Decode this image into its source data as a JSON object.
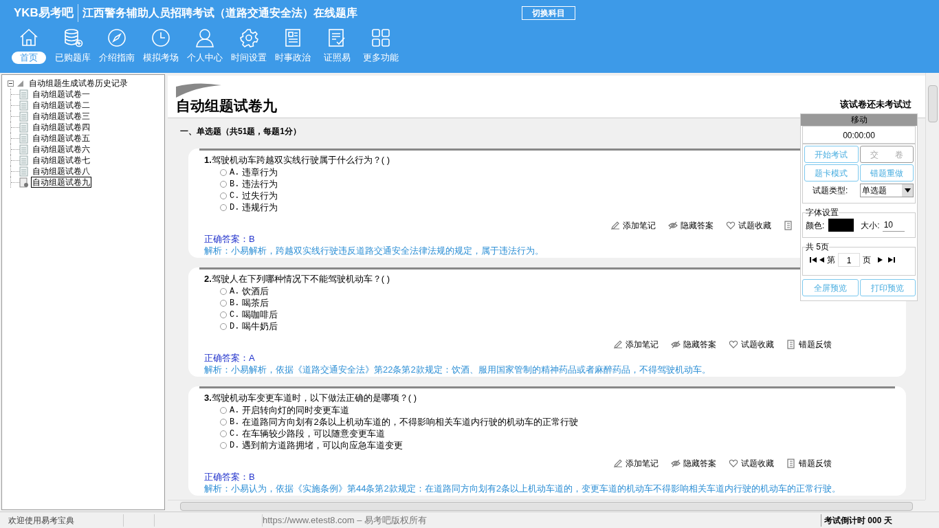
{
  "header": {
    "logo": "YKB易考吧",
    "title": "江西警务辅助人员招聘考试（道路交通安全法）在线题库",
    "switch_button": "切换科目"
  },
  "toolbar": [
    {
      "label": "首页",
      "selected": true
    },
    {
      "label": "已购题库",
      "selected": false
    },
    {
      "label": "介绍指南",
      "selected": false
    },
    {
      "label": "模拟考场",
      "selected": false
    },
    {
      "label": "个人中心",
      "selected": false
    },
    {
      "label": "时间设置",
      "selected": false
    },
    {
      "label": "时事政治",
      "selected": false
    },
    {
      "label": "证照易",
      "selected": false
    },
    {
      "label": "更多功能",
      "selected": false
    }
  ],
  "tree": {
    "label": "自动组题生成试卷历史记录",
    "expanded": true,
    "children": [
      {
        "label": "自动组题试卷一",
        "selected": false
      },
      {
        "label": "自动组题试卷二",
        "selected": false
      },
      {
        "label": "自动组题试卷三",
        "selected": false
      },
      {
        "label": "自动组题试卷四",
        "selected": false
      },
      {
        "label": "自动组题试卷五",
        "selected": false
      },
      {
        "label": "自动组题试卷六",
        "selected": false
      },
      {
        "label": "自动组题试卷七",
        "selected": false
      },
      {
        "label": "自动组题试卷八",
        "selected": false
      },
      {
        "label": "自动组题试卷九",
        "selected": true
      }
    ]
  },
  "paper": {
    "title": "自动组题试卷九",
    "status": "该试卷还未考试过",
    "section": "一、单选题（共51题，每题1分）"
  },
  "questions": [
    {
      "number": "1.",
      "text": "驾驶机动车跨越双实线行驶属于什么行为？( )",
      "options": [
        {
          "letter": "A.",
          "text": "违章行为",
          "selected": false
        },
        {
          "letter": "B.",
          "text": "违法行为",
          "selected": false
        },
        {
          "letter": "C.",
          "text": "过失行为",
          "selected": false
        },
        {
          "letter": "D.",
          "text": "违规行为",
          "selected": false
        }
      ],
      "answer": "正确答案：B",
      "analysis": "解析：小易解析，跨越双实线行驶违反道路交通安全法律法规的规定，属于违法行为。",
      "actions": [
        "添加笔记",
        "隐藏答案",
        "试题收藏"
      ]
    },
    {
      "number": "2.",
      "text": "驾驶人在下列哪种情况下不能驾驶机动车？( )",
      "options": [
        {
          "letter": "A.",
          "text": "饮酒后",
          "selected": false
        },
        {
          "letter": "B.",
          "text": "喝茶后",
          "selected": false
        },
        {
          "letter": "C.",
          "text": "喝咖啡后",
          "selected": false
        },
        {
          "letter": "D.",
          "text": "喝牛奶后",
          "selected": false
        }
      ],
      "answer": "正确答案：A",
      "analysis": "解析：小易解析，依据《道路交通安全法》第22条第2款规定：饮酒、服用国家管制的精神药品或者麻醉药品，不得驾驶机动车。",
      "actions": [
        "添加笔记",
        "隐藏答案",
        "试题收藏",
        "错题反馈"
      ]
    },
    {
      "number": "3.",
      "text": "驾驶机动车变更车道时，以下做法正确的是哪项？( )",
      "options": [
        {
          "letter": "A.",
          "text": "开启转向灯的同时变更车道",
          "selected": false
        },
        {
          "letter": "B.",
          "text": "在道路同方向划有2条以上机动车道的，不得影响相关车道内行驶的机动车的正常行驶",
          "selected": false
        },
        {
          "letter": "C.",
          "text": "在车辆较少路段，可以随意变更车道",
          "selected": false
        },
        {
          "letter": "D.",
          "text": "遇到前方道路拥堵，可以向应急车道变更",
          "selected": false
        }
      ],
      "answer": "正确答案：B",
      "analysis": "解析：小易认为，依据《实施条例》第44条第2款规定：在道路同方向划有2条以上机动车道的，变更车道的机动车不得影响相关车道内行驶的机动车的正常行驶。",
      "actions": [
        "添加笔记",
        "隐藏答案",
        "试题收藏",
        "错题反馈"
      ]
    }
  ],
  "panel": {
    "handle": "移动",
    "timer": "00:00:00",
    "buttons": [
      {
        "label": "开始考试",
        "disabled": false
      },
      {
        "label": "交　　卷",
        "disabled": true
      },
      {
        "label": "题卡模式",
        "disabled": false
      },
      {
        "label": "错题重做",
        "disabled": false
      }
    ],
    "type_label": "试题类型:",
    "type_value": "单选题",
    "font_group": "字体设置",
    "color_label": "颜色:",
    "size_label": "大小:",
    "size_value": "10",
    "pages_group": "共 5页",
    "page_prefix": "第",
    "page_value": "1",
    "page_suffix": "页",
    "bottom_buttons": [
      "全屏预览",
      "打印预览"
    ]
  },
  "status_bar": {
    "welcome": "欢迎使用易考宝典",
    "copyright": "https://www.etest8.com – 易考吧版权所有",
    "countdown": "考试倒计时 000 天"
  }
}
